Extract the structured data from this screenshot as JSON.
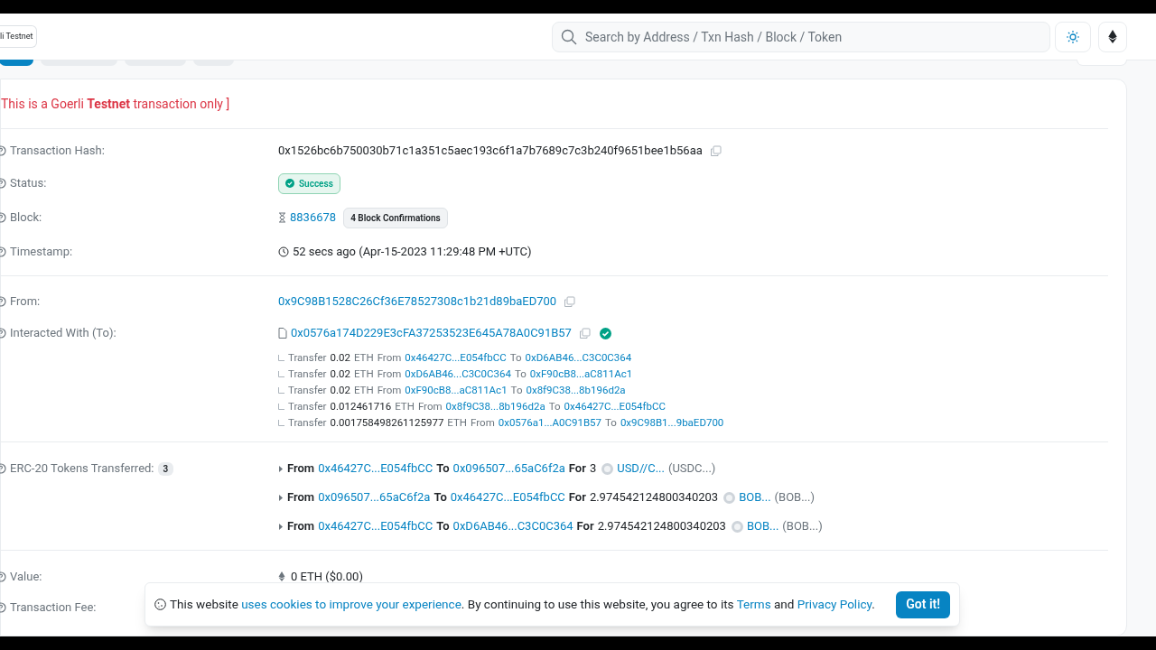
{
  "header": {
    "network_chip": "li Testnet",
    "search": {
      "placeholder": "Search by Address / Txn Hash / Block / Token"
    }
  },
  "tabs": [
    {
      "selected": true
    },
    {
      "selected": false
    },
    {
      "selected": false
    },
    {
      "selected": false
    }
  ],
  "alert": "This is a Goerli **Testnet** transaction only ]",
  "overview": [
    {
      "kind": "hash",
      "label": "Transaction Hash:",
      "value": "0x1526bc6b750030b71c1a351c5aec193c6f1a7b7689c7c3b240f9651bee1b56aa"
    },
    {
      "kind": "status",
      "label": "Status:",
      "value": "Success"
    },
    {
      "kind": "block",
      "label": "Block:",
      "value": "8836678",
      "badge": "4 Block Confirmations"
    },
    {
      "kind": "time",
      "label": "Timestamp:",
      "value": "52 secs ago (Apr-15-2023 11:29:48 PM +UTC)"
    }
  ],
  "parties": {
    "from": {
      "label": "From:",
      "value": "0x9C98B1528C26Cf36E78527308c1b21d89baED700"
    },
    "to": {
      "label": "Interacted With (To):",
      "value": "0x0576a174D229E3cFA37253523E645A78A0C91B57",
      "verified": true
    },
    "internal_transfers": [
      {
        "label": "Transfer",
        "amount": "0.02",
        "unit": "ETH",
        "from_label": "From",
        "from": "0x46427C...E054fbCC",
        "to_label": "To",
        "to": "0xD6AB46...C3C0C364"
      },
      {
        "label": "Transfer",
        "amount": "0.02",
        "unit": "ETH",
        "from_label": "From",
        "from": "0xD6AB46...C3C0C364",
        "to_label": "To",
        "to": "0xF90cB8...aC811Ac1"
      },
      {
        "label": "Transfer",
        "amount": "0.02",
        "unit": "ETH",
        "from_label": "From",
        "from": "0xF90cB8...aC811Ac1",
        "to_label": "To",
        "to": "0x8f9C38...8b196d2a"
      },
      {
        "label": "Transfer",
        "amount": "0.012461716",
        "unit": "ETH",
        "from_label": "From",
        "from": "0x8f9C38...8b196d2a",
        "to_label": "To",
        "to": "0x46427C...E054fbCC"
      },
      {
        "label": "Transfer",
        "amount": "0.001758498261125977",
        "unit": "ETH",
        "from_label": "From",
        "from": "0x0576a1...A0C91B57",
        "to_label": "To",
        "to": "0x9C98B1...9baED700"
      }
    ]
  },
  "tokens": {
    "label": "ERC-20 Tokens Transferred:",
    "count": "3",
    "rows": [
      {
        "from_label": "From",
        "from": "0x46427C...E054fbCC",
        "to_label": "To",
        "to": "0x096507...65aC6f2a",
        "for_label": "For",
        "amount": "3",
        "token": "USD//C...",
        "symbol": "(USDC...)"
      },
      {
        "from_label": "From",
        "from": "0x096507...65aC6f2a",
        "to_label": "To",
        "to": "0x46427C...E054fbCC",
        "for_label": "For",
        "amount": "2.974542124800340203",
        "token": "BOB...",
        "symbol": "(BOB...)"
      },
      {
        "from_label": "From",
        "from": "0x46427C...E054fbCC",
        "to_label": "To",
        "to": "0xD6AB46...C3C0C364",
        "for_label": "For",
        "amount": "2.974542124800340203",
        "token": "BOB...",
        "symbol": "(BOB...)"
      }
    ]
  },
  "value": {
    "label": "Value:",
    "value": "0 ETH ($0.00)"
  },
  "fee": {
    "label": "Transaction Fee:"
  },
  "cookie": {
    "text1": "This website",
    "link1": "uses cookies to improve your experience",
    "text2": ". By continuing to use this website, you agree to its",
    "terms": "Terms",
    "and": "and",
    "privacy": "Privacy Policy",
    "end": ".",
    "button": "Got it!"
  }
}
